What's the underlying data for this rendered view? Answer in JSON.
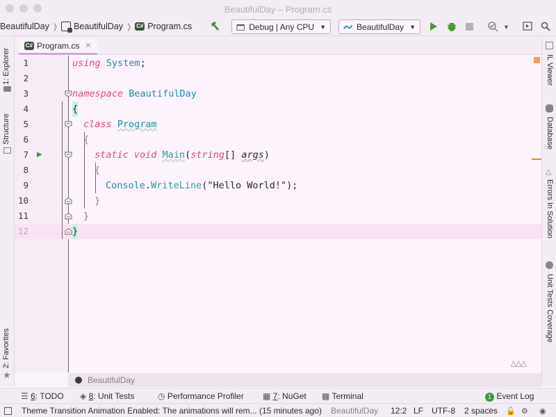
{
  "window": {
    "title": "BeautifulDay – Program.cs"
  },
  "breadcrumb": {
    "item1": "BeautifulDay",
    "item2": "BeautifulDay",
    "item3": "Program.cs"
  },
  "toolbar": {
    "config_combo": "Debug | Any CPU",
    "run_combo": "BeautifulDay"
  },
  "left_strip": {
    "explorer": "1: Explorer",
    "structure": "Structure",
    "favorites": "2: Favorites"
  },
  "right_strip": {
    "il_viewer": "IL Viewer",
    "database": "Database",
    "errors": "Errors In Solution",
    "unit_tests": "Unit Tests Coverage"
  },
  "editor_tab": {
    "label": "Program.cs"
  },
  "code": {
    "line_numbers": [
      "1",
      "2",
      "3",
      "4",
      "5",
      "6",
      "7",
      "8",
      "9",
      "10",
      "11",
      "12"
    ],
    "l1_kw": "using",
    "l1_ns": "System",
    "l1_end": ";",
    "l3_kw": "namespace",
    "l3_name": "BeautifulDay",
    "l4": "{",
    "l5_kw": "class",
    "l5_name": "Program",
    "l6": "{",
    "l7_kw1": "static",
    "l7_kw2": "void",
    "l7_fn": "Main",
    "l7_p1": "(",
    "l7_type": "string",
    "l7_arr": "[] ",
    "l7_arg": "args",
    "l7_p2": ")",
    "l8": "{",
    "l9_cls": "Console",
    "l9_dot": ".",
    "l9_fn": "WriteLine",
    "l9_p1": "(",
    "l9_str": "\"Hello World!\"",
    "l9_p2": ");",
    "l10": "}",
    "l11": "}",
    "l12": "}"
  },
  "editor_breadcrumb": {
    "label": "BeautifulDay"
  },
  "tool_windows": {
    "todo_num": "6",
    "todo": ": TODO",
    "unit_num": "8",
    "unit": ": Unit Tests",
    "profiler": "Performance Profiler",
    "nuget_num": "7",
    "nuget": ": NuGet",
    "terminal": "Terminal",
    "event_count": "1",
    "event_log": "Event Log"
  },
  "status_bar": {
    "message": "Theme Transition Animation Enabled: The animations will rem... (15 minutes ago)",
    "project": "BeautifulDay",
    "position": "12:2",
    "line_sep": "LF",
    "encoding": "UTF-8",
    "indent": "2 spaces"
  },
  "colors": {
    "keyword": "#e0457b",
    "type": "#1b8fa6",
    "run": "#4a8c3c",
    "accent": "#c9a8d6"
  }
}
